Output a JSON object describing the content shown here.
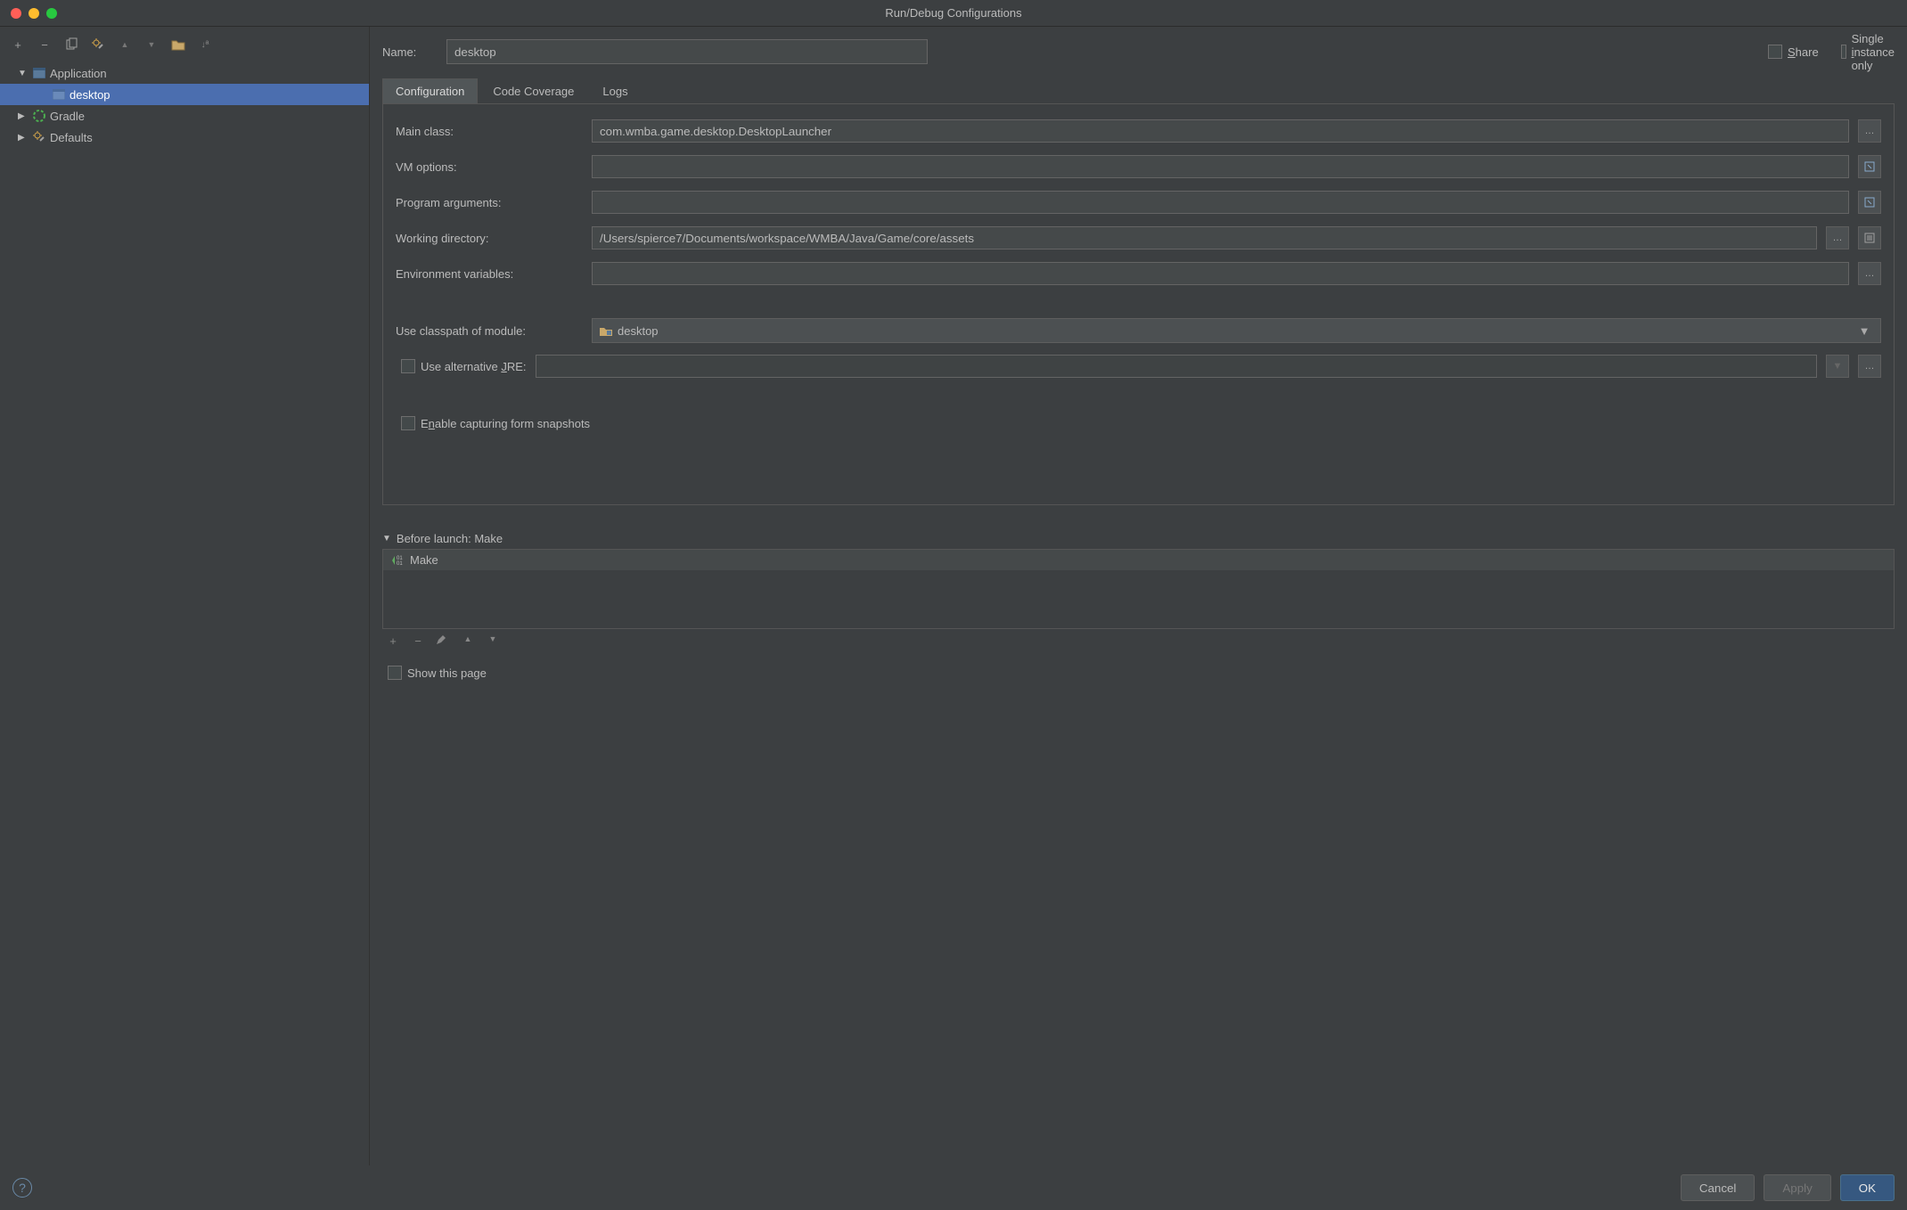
{
  "window": {
    "title": "Run/Debug Configurations"
  },
  "toolbar": {
    "add": "+",
    "remove": "−",
    "copy": "copy",
    "settings": "settings",
    "up": "▲",
    "down": "▼",
    "folder": "folder",
    "sort": "sort"
  },
  "tree": {
    "nodes": [
      {
        "label": "Application",
        "expanded": true,
        "icon": "app-window-icon",
        "depth": 1
      },
      {
        "label": "desktop",
        "selected": true,
        "icon": "app-window-icon",
        "depth": 2
      },
      {
        "label": "Gradle",
        "expanded": false,
        "icon": "gradle-icon",
        "depth": 1
      },
      {
        "label": "Defaults",
        "expanded": false,
        "icon": "wrench-icon",
        "depth": 1
      }
    ]
  },
  "name_row": {
    "label": "Name:",
    "value": "desktop",
    "share": "Share",
    "single_instance": "Single instance only"
  },
  "tabs": {
    "items": [
      "Configuration",
      "Code Coverage",
      "Logs"
    ],
    "active": 0
  },
  "form": {
    "main_class": {
      "label": "Main class:",
      "value": "com.wmba.game.desktop.DesktopLauncher"
    },
    "vm_options": {
      "label": "VM options:",
      "value": ""
    },
    "program_args": {
      "label": "Program arguments:",
      "value": ""
    },
    "working_dir": {
      "label": "Working directory:",
      "value": "/Users/spierce7/Documents/workspace/WMBA/Java/Game/core/assets"
    },
    "env_vars": {
      "label": "Environment variables:",
      "value": ""
    },
    "classpath": {
      "label": "Use classpath of module:",
      "value": "desktop"
    },
    "alt_jre": {
      "label": "Use alternative JRE:",
      "value": ""
    },
    "snapshots": {
      "label": "Enable capturing form snapshots"
    }
  },
  "before_launch": {
    "header": "Before launch: Make",
    "items": [
      "Make"
    ],
    "show_this_page": "Show this page"
  },
  "footer": {
    "cancel": "Cancel",
    "apply": "Apply",
    "ok": "OK"
  }
}
